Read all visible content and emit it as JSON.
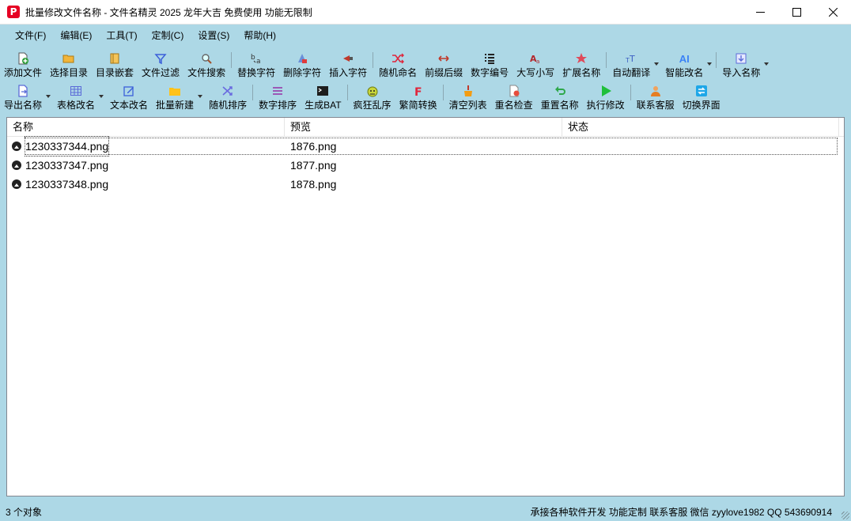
{
  "window": {
    "title": "批量修改文件名称 - 文件名精灵 2025 龙年大吉 免费使用 功能无限制",
    "app_icon": "P"
  },
  "menu": [
    "文件(F)",
    "编辑(E)",
    "工具(T)",
    "定制(C)",
    "设置(S)",
    "帮助(H)"
  ],
  "toolbar1": [
    {
      "label": "添加文件",
      "icon": "add-file-icon"
    },
    {
      "label": "选择目录",
      "icon": "folder-open-icon"
    },
    {
      "label": "目录嵌套",
      "icon": "nested-folder-icon"
    },
    {
      "label": "文件过滤",
      "icon": "filter-icon"
    },
    {
      "label": "文件搜索",
      "icon": "search-icon"
    },
    {
      "label": "替换字符",
      "icon": "replace-text-icon"
    },
    {
      "label": "删除字符",
      "icon": "delete-text-icon"
    },
    {
      "label": "插入字符",
      "icon": "insert-text-icon"
    },
    {
      "label": "随机命名",
      "icon": "shuffle-icon"
    },
    {
      "label": "前缀后缀",
      "icon": "prefix-suffix-icon"
    },
    {
      "label": "数字编号",
      "icon": "numbered-list-icon"
    },
    {
      "label": "大写小写",
      "icon": "case-icon"
    },
    {
      "label": "扩展名称",
      "icon": "star-icon"
    },
    {
      "label": "自动翻译",
      "icon": "translate-icon"
    },
    {
      "label": "智能改名",
      "icon": "ai-icon"
    },
    {
      "label": "导入名称",
      "icon": "import-icon"
    }
  ],
  "toolbar1_ai_text": "AI",
  "toolbar2": [
    {
      "label": "导出名称",
      "icon": "export-icon"
    },
    {
      "label": "表格改名",
      "icon": "table-icon"
    },
    {
      "label": "文本改名",
      "icon": "edit-icon"
    },
    {
      "label": "批量新建",
      "icon": "new-folder-icon"
    },
    {
      "label": "随机排序",
      "icon": "random-sort-icon"
    },
    {
      "label": "数字排序",
      "icon": "number-sort-icon"
    },
    {
      "label": "生成BAT",
      "icon": "terminal-icon"
    },
    {
      "label": "疯狂乱序",
      "icon": "crazy-icon"
    },
    {
      "label": "繁简转换",
      "icon": "convert-icon"
    },
    {
      "label": "清空列表",
      "icon": "clear-icon"
    },
    {
      "label": "重名检查",
      "icon": "duplicate-check-icon"
    },
    {
      "label": "重置名称",
      "icon": "undo-icon"
    },
    {
      "label": "执行修改",
      "icon": "play-icon"
    },
    {
      "label": "联系客服",
      "icon": "support-icon"
    },
    {
      "label": "切换界面",
      "icon": "switch-icon"
    }
  ],
  "list": {
    "columns": [
      "名称",
      "预览",
      "状态"
    ],
    "rows": [
      {
        "name": "1230337344.png",
        "preview": "1876.png",
        "status": ""
      },
      {
        "name": "1230337347.png",
        "preview": "1877.png",
        "status": ""
      },
      {
        "name": "1230337348.png",
        "preview": "1878.png",
        "status": ""
      }
    ]
  },
  "status": {
    "count": "3 个对象",
    "info": "承接各种软件开发 功能定制 联系客服 微信 zyylove1982 QQ 543690914"
  }
}
